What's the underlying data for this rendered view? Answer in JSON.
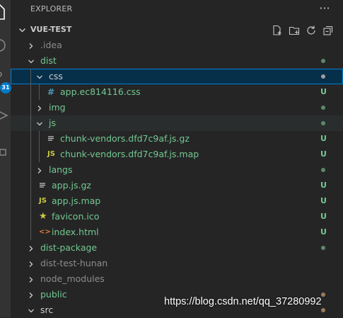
{
  "explorer": {
    "title": "EXPLORER",
    "more_label": "···",
    "section_title": "VUE-TEST"
  },
  "activity": {
    "badge": "31",
    "icons": [
      "files-icon",
      "search-icon",
      "source-control-icon",
      "run-debug-icon",
      "extensions-icon"
    ]
  },
  "tree": [
    {
      "name": ".idea",
      "kind": "folder",
      "expanded": false,
      "depth": 1,
      "color": "grey",
      "deco": ""
    },
    {
      "name": "dist",
      "kind": "folder",
      "expanded": true,
      "depth": 1,
      "color": "green",
      "deco": "dot"
    },
    {
      "name": "css",
      "kind": "folder",
      "expanded": true,
      "depth": 2,
      "color": "white",
      "deco": "dot",
      "selected": true
    },
    {
      "name": "app.ec814116.css",
      "kind": "css",
      "depth": 3,
      "color": "green",
      "deco": "U"
    },
    {
      "name": "img",
      "kind": "folder",
      "expanded": false,
      "depth": 2,
      "color": "green",
      "deco": "dot"
    },
    {
      "name": "js",
      "kind": "folder",
      "expanded": true,
      "depth": 2,
      "color": "green",
      "deco": "dot",
      "hover": true
    },
    {
      "name": "chunk-vendors.dfd7c9af.js.gz",
      "kind": "lines",
      "depth": 3,
      "color": "green",
      "deco": "U"
    },
    {
      "name": "chunk-vendors.dfd7c9af.js.map",
      "kind": "js",
      "depth": 3,
      "color": "green",
      "deco": "U"
    },
    {
      "name": "langs",
      "kind": "folder",
      "expanded": false,
      "depth": 2,
      "color": "green",
      "deco": "dot"
    },
    {
      "name": "app.js.gz",
      "kind": "lines",
      "depth": 2,
      "color": "green",
      "deco": "U"
    },
    {
      "name": "app.js.map",
      "kind": "js",
      "depth": 2,
      "color": "green",
      "deco": "U"
    },
    {
      "name": "favicon.ico",
      "kind": "star",
      "depth": 2,
      "color": "green",
      "deco": "U"
    },
    {
      "name": "index.html",
      "kind": "html",
      "depth": 2,
      "color": "green",
      "deco": "U"
    },
    {
      "name": "dist-package",
      "kind": "folder",
      "expanded": false,
      "depth": 1,
      "color": "green",
      "deco": "dot"
    },
    {
      "name": "dist-test-hunan",
      "kind": "folder",
      "expanded": false,
      "depth": 1,
      "color": "grey",
      "deco": ""
    },
    {
      "name": "node_modules",
      "kind": "folder",
      "expanded": false,
      "depth": 1,
      "color": "grey",
      "deco": ""
    },
    {
      "name": "public",
      "kind": "folder",
      "expanded": false,
      "depth": 1,
      "color": "green",
      "deco": "dot-orange"
    },
    {
      "name": "src",
      "kind": "folder",
      "expanded": true,
      "depth": 1,
      "color": "white",
      "deco": "dot-orange"
    }
  ],
  "icon_glyphs": {
    "css": "#",
    "js": "JS",
    "html": "<>",
    "star": "★"
  },
  "colors": {
    "green": "#73c991",
    "white": "#cccccc",
    "grey": "#8c8c8c",
    "dot": "#5a8a6a",
    "dot-selected": "#a0a0a0",
    "dot-orange": "#9e7a5a",
    "accent": "#007acc"
  },
  "watermark": "https://blog.csdn.net/qq_37280992"
}
